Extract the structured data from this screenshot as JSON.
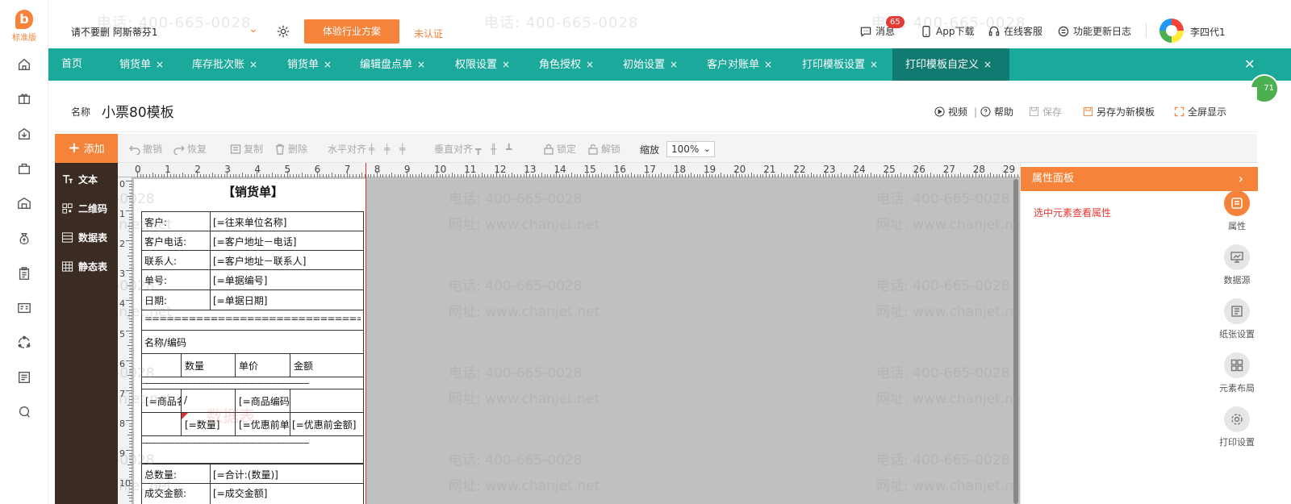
{
  "rail": {
    "logo_mark": "b",
    "logo_version": "标准版",
    "icons": [
      "home-icon",
      "gift-icon",
      "box-in-icon",
      "bag-icon",
      "warehouse-icon",
      "money-bag-icon",
      "clipboard-icon",
      "id-card-icon",
      "cycle-icon",
      "news-icon",
      "chat-icon"
    ]
  },
  "header": {
    "company": "请不要删 阿斯蒂芬1",
    "industry_button": "体验行业方案",
    "uncertified": "未认证",
    "messages_label": "消息",
    "messages_count": "65",
    "app_download": "App下载",
    "online_service": "在线客服",
    "update_log": "功能更新日志",
    "username": "李四代1",
    "watermark_phone": "电话: 400-665-0028",
    "watermark_site": "网址: www.chanjet.net"
  },
  "tabs": [
    {
      "label": "首页",
      "closable": false
    },
    {
      "label": "销货单",
      "closable": true
    },
    {
      "label": "库存批次账",
      "closable": true
    },
    {
      "label": "销货单",
      "closable": true
    },
    {
      "label": "编辑盘点单",
      "closable": true
    },
    {
      "label": "权限设置",
      "closable": true
    },
    {
      "label": "角色授权",
      "closable": true
    },
    {
      "label": "初始设置",
      "closable": true
    },
    {
      "label": "客户对账单",
      "closable": true
    },
    {
      "label": "打印模板设置",
      "closable": true
    },
    {
      "label": "打印模板自定义",
      "closable": true,
      "active": true
    }
  ],
  "tab_close_symbol": "×",
  "green_badge": "71",
  "namebar": {
    "label": "名称",
    "value": "小票80模板",
    "video": "视频",
    "help": "帮助",
    "save": "保存",
    "save_as": "另存为新模板",
    "fullscreen": "全屏显示"
  },
  "toolbar": {
    "add": "添加",
    "undo": "撤销",
    "redo": "恢复",
    "copy": "复制",
    "delete": "删除",
    "h_align": "水平对齐",
    "v_align": "垂直对齐",
    "lock": "锁定",
    "unlock": "解锁",
    "zoom_label": "缩放",
    "zoom_value": "100%"
  },
  "palette": [
    {
      "label": "文本",
      "icon": "text-icon"
    },
    {
      "label": "二维码",
      "icon": "qrcode-icon"
    },
    {
      "label": "数据表",
      "icon": "data-table-icon"
    },
    {
      "label": "静态表",
      "icon": "static-table-icon"
    }
  ],
  "ruler": {
    "top": [
      "0",
      "1",
      "2",
      "3",
      "4",
      "5",
      "6",
      "7",
      "8",
      "9",
      "10",
      "11",
      "12",
      "13",
      "14",
      "15",
      "16",
      "17",
      "18",
      "19",
      "20",
      "21",
      "22",
      "23",
      "24",
      "25",
      "26",
      "27",
      "28",
      "29"
    ],
    "left": [
      "0",
      "1",
      "2",
      "3",
      "4",
      "5",
      "6",
      "7",
      "8",
      "9",
      "10"
    ]
  },
  "receipt": {
    "title": "【销货单】",
    "rows": [
      {
        "label": "客户:",
        "value": "[=往来单位名称]"
      },
      {
        "label": "客户电话:",
        "value": "[=客户地址－电话]"
      },
      {
        "label": "联系人:",
        "value": "[=客户地址－联系人]"
      },
      {
        "label": "单号:",
        "value": "[=单据编号]"
      },
      {
        "label": "日期:",
        "value": "[=单据日期]"
      }
    ],
    "equals_line": "=====================================",
    "name_code_header": "名称/编码",
    "col_headers": [
      "数量",
      "单价",
      "金额"
    ],
    "dash_line": "--------------------------------------------------------------",
    "item_row1": [
      "[=商品名",
      "/",
      "[=商品编码"
    ],
    "item_row2": [
      "[=数量]",
      "[=优惠前单",
      "[=优惠前金额]"
    ],
    "total_qty_label": "总数量:",
    "total_qty_value": "[=合计:(数量)]",
    "total_amount_label": "成交金额:",
    "total_amount_value": "[=成交金额]",
    "stamp_text": "数据表"
  },
  "properties": {
    "title": "属性面板",
    "arrow": "›",
    "hint": "选中元素查看属性",
    "tools": [
      {
        "label": "属性",
        "icon": "property-icon",
        "active": true
      },
      {
        "label": "数据源",
        "icon": "monitor-icon",
        "active": false
      },
      {
        "label": "纸张设置",
        "icon": "paper-icon",
        "active": false
      },
      {
        "label": "元素布局",
        "icon": "grid-layout-icon",
        "active": false
      },
      {
        "label": "打印设置",
        "icon": "gear-icon",
        "active": false
      }
    ]
  },
  "colors": {
    "orange": "#f5833a",
    "teal": "#1aa99b",
    "teal_dark": "#107a70",
    "palette_bg": "#3a2c22"
  }
}
